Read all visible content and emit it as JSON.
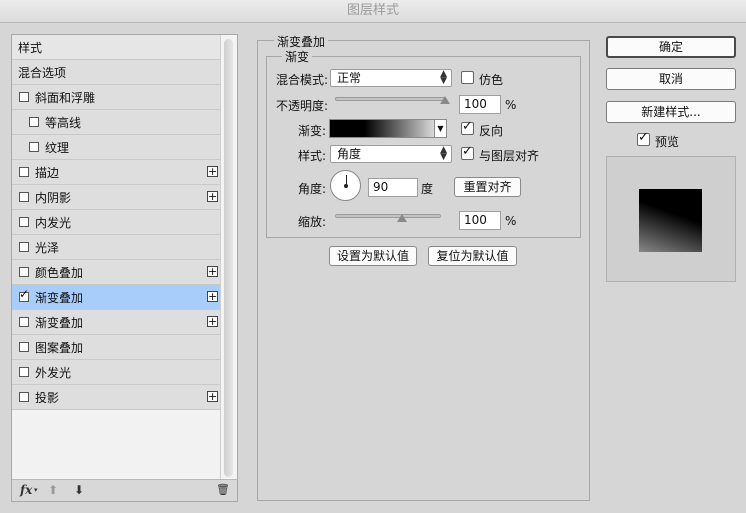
{
  "window": {
    "title": "图层样式"
  },
  "left_panel": {
    "header": "样式",
    "blend_options": "混合选项",
    "items": [
      {
        "label": "斜面和浮雕",
        "checked": false,
        "indent": false,
        "plus": false
      },
      {
        "label": "等高线",
        "checked": false,
        "indent": true,
        "plus": false
      },
      {
        "label": "纹理",
        "checked": false,
        "indent": true,
        "plus": false
      },
      {
        "label": "描边",
        "checked": false,
        "indent": false,
        "plus": true
      },
      {
        "label": "内阴影",
        "checked": false,
        "indent": false,
        "plus": true
      },
      {
        "label": "内发光",
        "checked": false,
        "indent": false,
        "plus": false
      },
      {
        "label": "光泽",
        "checked": false,
        "indent": false,
        "plus": false
      },
      {
        "label": "颜色叠加",
        "checked": false,
        "indent": false,
        "plus": true
      },
      {
        "label": "渐变叠加",
        "checked": true,
        "indent": false,
        "plus": true,
        "selected": true
      },
      {
        "label": "渐变叠加",
        "checked": false,
        "indent": false,
        "plus": true
      },
      {
        "label": "图案叠加",
        "checked": false,
        "indent": false,
        "plus": false
      },
      {
        "label": "外发光",
        "checked": false,
        "indent": false,
        "plus": false
      },
      {
        "label": "投影",
        "checked": false,
        "indent": false,
        "plus": true
      }
    ],
    "bottom": {
      "fx": "fx",
      "up": "⬆",
      "down": "⬇",
      "trash": "🗑"
    }
  },
  "gradient_overlay": {
    "section_title": "渐变叠加",
    "group_title": "渐变",
    "blend_mode_label": "混合模式:",
    "blend_mode_value": "正常",
    "dither_label": "仿色",
    "dither_checked": false,
    "opacity_label": "不透明度:",
    "opacity_value": "100",
    "opacity_fraction": 1.0,
    "percent": "%",
    "gradient_label": "渐变:",
    "reverse_label": "反向",
    "reverse_checked": true,
    "style_label": "样式:",
    "style_value": "角度",
    "align_label": "与图层对齐",
    "align_checked": true,
    "angle_label": "角度:",
    "angle_value": "90",
    "angle_unit": "度",
    "reset_align_button": "重置对齐",
    "scale_label": "缩放:",
    "scale_value": "100",
    "scale_fraction": 0.5,
    "set_default_button": "设置为默认值",
    "reset_default_button": "复位为默认值"
  },
  "right_panel": {
    "ok_button": "确定",
    "cancel_button": "取消",
    "new_style_button": "新建样式...",
    "preview_label": "预览",
    "preview_checked": true
  },
  "colors": {
    "selected_row": "#a8cdfb",
    "background": "#d6d6d6"
  }
}
